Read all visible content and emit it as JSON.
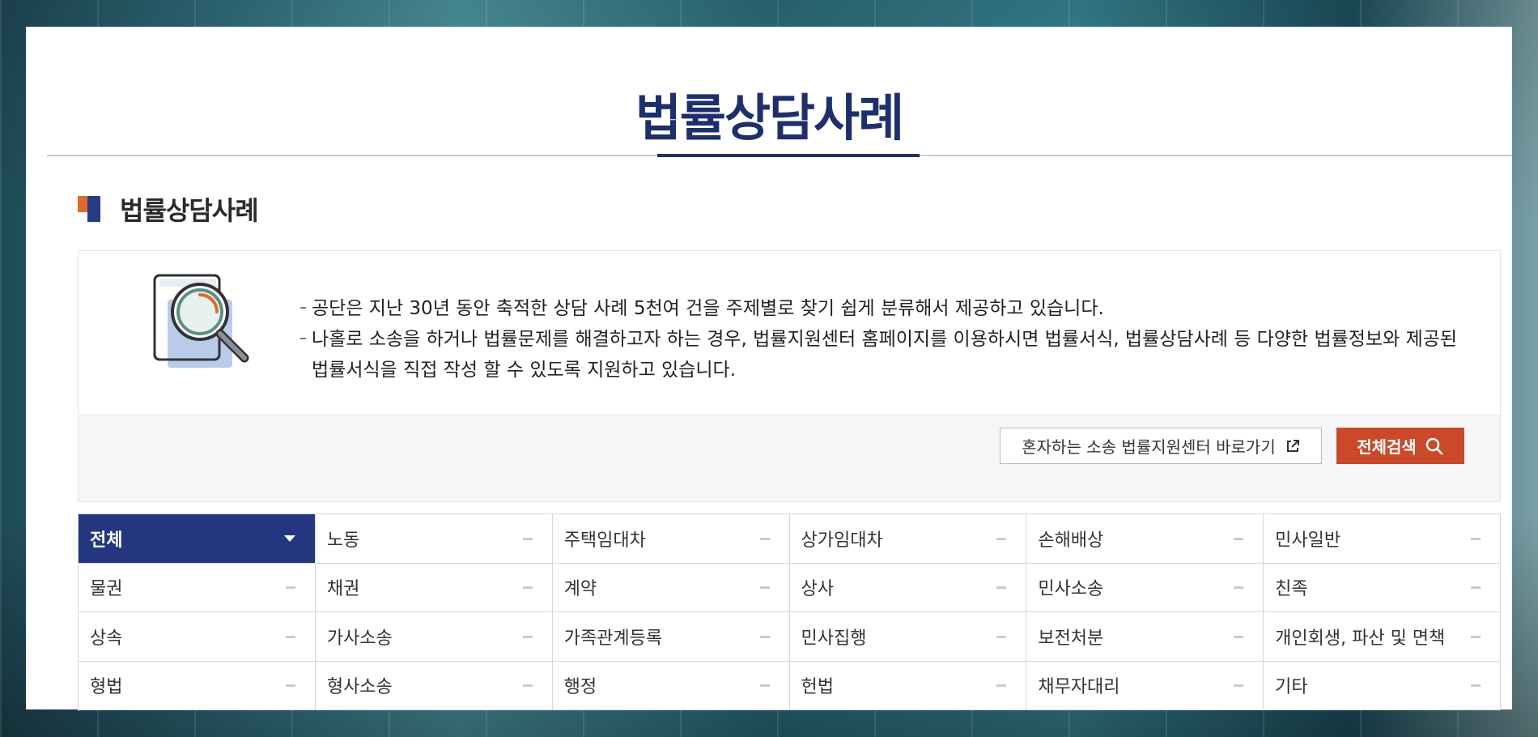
{
  "page": {
    "title": "법률상담사례",
    "section_title": "법률상담사례"
  },
  "info": {
    "lines": [
      "공단은 지난 30년 동안 축적한 상담 사례 5천여 건을 주제별로 찾기 쉽게 분류해서 제공하고 있습니다.",
      "나홀로 소송을 하거나 법률문제를 해결하고자 하는 경우, 법률지원센터 홈페이지를 이용하시면 법률서식, 법률상담사례 등 다양한 법률정보와 제공된 법률서식을 직접 작성 할 수 있도록 지원하고 있습니다."
    ],
    "icon": "document-magnifier-icon"
  },
  "buttons": {
    "center_link": "혼자하는 소송 법률지원센터 바로가기",
    "search_all": "전체검색"
  },
  "categories": [
    {
      "label": "전체",
      "active": true
    },
    {
      "label": "노동"
    },
    {
      "label": "주택임대차"
    },
    {
      "label": "상가임대차"
    },
    {
      "label": "손해배상"
    },
    {
      "label": "민사일반"
    },
    {
      "label": "물권"
    },
    {
      "label": "채권"
    },
    {
      "label": "계약"
    },
    {
      "label": "상사"
    },
    {
      "label": "민사소송"
    },
    {
      "label": "친족"
    },
    {
      "label": "상속"
    },
    {
      "label": "가사소송"
    },
    {
      "label": "가족관계등록"
    },
    {
      "label": "민사집행"
    },
    {
      "label": "보전처분"
    },
    {
      "label": "개인회생, 파산 및 면책"
    },
    {
      "label": "형법"
    },
    {
      "label": "형사소송"
    },
    {
      "label": "행정"
    },
    {
      "label": "헌법"
    },
    {
      "label": "채무자대리"
    },
    {
      "label": "기타"
    }
  ],
  "colors": {
    "brand_navy": "#1e2f6b",
    "active_tab": "#253680",
    "search_button": "#c9492a",
    "accent_orange": "#e06a2a"
  }
}
